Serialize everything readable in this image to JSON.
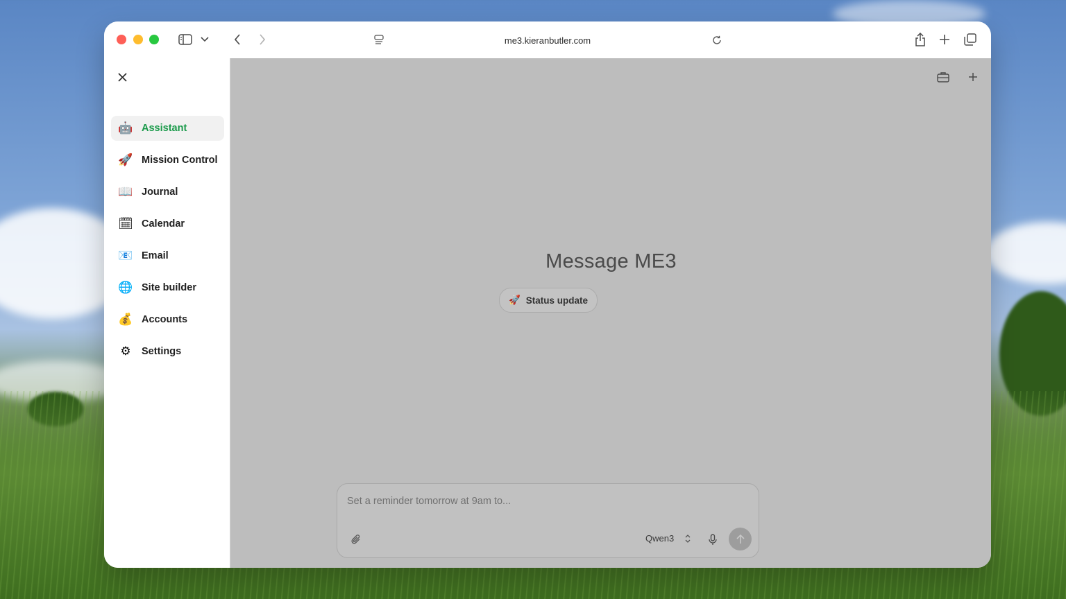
{
  "browser": {
    "url": "me3.kieranbutler.com"
  },
  "sidebar": {
    "items": [
      {
        "label": "Assistant",
        "emoji": "🤖",
        "icon": "robot-icon",
        "active": true
      },
      {
        "label": "Mission Control",
        "emoji": "🚀",
        "icon": "rocket-icon"
      },
      {
        "label": "Journal",
        "emoji": "📖",
        "icon": "book-icon"
      },
      {
        "label": "Calendar",
        "emoji": "🗓",
        "icon": "calendar-icon"
      },
      {
        "label": "Email",
        "emoji": "📧",
        "icon": "email-icon"
      },
      {
        "label": "Site builder",
        "emoji": "🌐",
        "icon": "globe-icon"
      },
      {
        "label": "Accounts",
        "emoji": "💰",
        "icon": "money-bag-icon"
      },
      {
        "label": "Settings",
        "emoji": "⚙",
        "icon": "gear-icon"
      }
    ]
  },
  "main": {
    "title": "Message ME3",
    "suggestion": {
      "emoji": "🚀",
      "label": "Status update"
    },
    "composer": {
      "placeholder": "Set a reminder tomorrow at 9am to...",
      "model": "Qwen3"
    }
  },
  "colors": {
    "accent": "#1a9a4a",
    "overlay": "#bdbdbd"
  }
}
